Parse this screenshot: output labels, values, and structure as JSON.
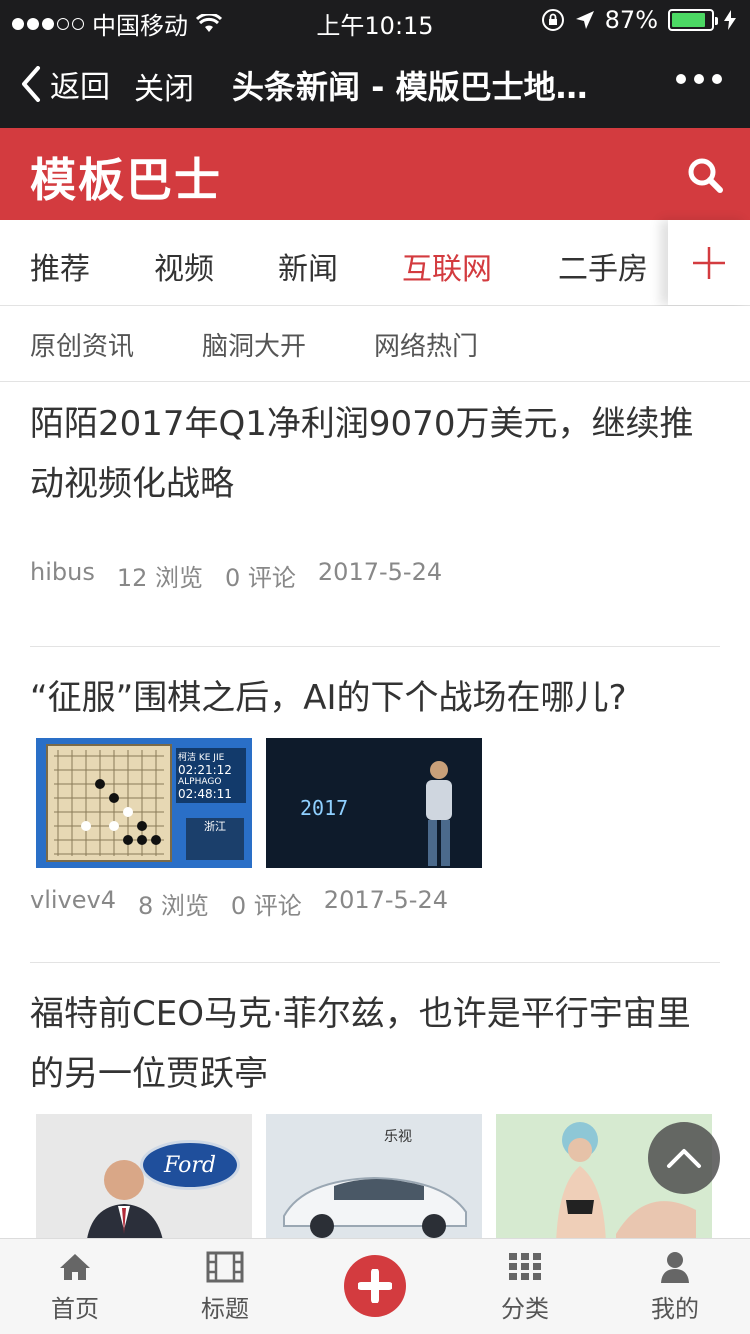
{
  "status_bar": {
    "carrier": "中国移动",
    "time": "上午10:15",
    "battery": "87%",
    "battery_level": 0.87
  },
  "nav_bar": {
    "back_label": "返回",
    "close_label": "关闭",
    "title": "头条新闻 - 模版巴士地…"
  },
  "brand": {
    "logo_text": "模板巴士",
    "accent_color": "#d33b3f"
  },
  "tabs": [
    {
      "label": "推荐",
      "active": false
    },
    {
      "label": "视频",
      "active": false
    },
    {
      "label": "新闻",
      "active": false
    },
    {
      "label": "互联网",
      "active": true
    },
    {
      "label": "二手房",
      "active": false
    }
  ],
  "subtabs": [
    "原创资讯",
    "脑洞大开",
    "网络热门"
  ],
  "articles": [
    {
      "title": "陌陌2017年Q1净利润9070万美元，继续推动视频化战略",
      "author": "hibus",
      "views": "12 浏览",
      "comments": "0 评论",
      "date": "2017-5-24",
      "thumbs": []
    },
    {
      "title": "“征服”围棋之后，AI的下个战场在哪儿?",
      "author": "vlivev4",
      "views": "8 浏览",
      "comments": "0 评论",
      "date": "2017-5-24",
      "thumbs": [
        {
          "label_1": "柯洁 KE JIE",
          "time_1": "02:21:12",
          "label_2": "ALPHAGO",
          "time_2": "02:48:11",
          "caption": "浙江"
        },
        {
          "year": "2017"
        }
      ]
    },
    {
      "title": "福特前CEO马克·菲尔兹，也许是平行宇宙里的另一位贾跃亭",
      "thumbs": [
        {
          "brand": "Ford"
        },
        {
          "brand": "乐视"
        },
        {}
      ]
    }
  ],
  "bottom_nav": [
    {
      "label": "首页",
      "icon": "home-icon"
    },
    {
      "label": "标题",
      "icon": "film-icon"
    },
    {
      "label": "",
      "icon": "plus-icon"
    },
    {
      "label": "分类",
      "icon": "grid-icon"
    },
    {
      "label": "我的",
      "icon": "user-icon"
    }
  ]
}
